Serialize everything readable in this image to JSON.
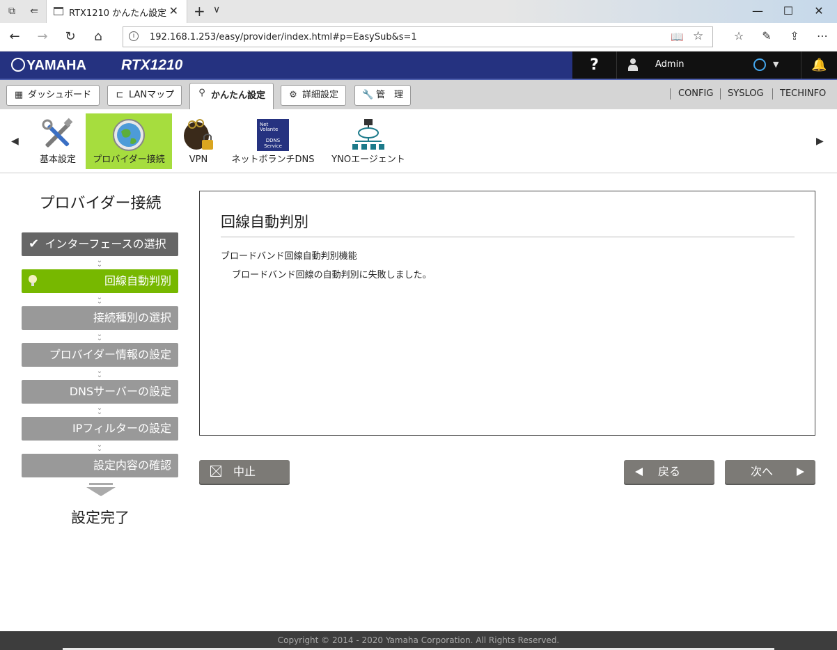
{
  "browser": {
    "tab_title": "RTX1210 かんたん設定 - ",
    "url": "192.168.1.253/easy/provider/index.html#p=EasySub&s=1"
  },
  "header": {
    "brand": "YAMAHA",
    "model": "RTX1210",
    "help_label": "?",
    "user": "Admin",
    "status_color": "#44a7ee"
  },
  "main_tabs": [
    {
      "label": "ダッシュボード",
      "icon": "dashboard-icon"
    },
    {
      "label": "LANマップ",
      "icon": "lan-map-icon"
    },
    {
      "label": "かんたん設定",
      "icon": "wand-icon",
      "active": true
    },
    {
      "label": "詳細設定",
      "icon": "gear-icon"
    },
    {
      "label": "管　理",
      "icon": "wrench-icon"
    }
  ],
  "top_links": [
    "CONFIG",
    "SYSLOG",
    "TECHINFO"
  ],
  "sub_items": [
    {
      "label": "基本設定",
      "icon": "tools-icon"
    },
    {
      "label": "プロバイダー接続",
      "icon": "globe-icon",
      "active": true
    },
    {
      "label": "VPN",
      "icon": "keys-lock-icon"
    },
    {
      "label": "ネットボランチDNS",
      "icon": "ddns-service-icon",
      "badge_text": "DDNS Service"
    },
    {
      "label": "YNOエージェント",
      "icon": "network-cloud-icon"
    }
  ],
  "sidebar": {
    "title": "プロバイダー接続",
    "steps": [
      {
        "label": "インターフェースの選択",
        "state": "done"
      },
      {
        "label": "回線自動判別",
        "state": "current"
      },
      {
        "label": "接続種別の選択",
        "state": "todo"
      },
      {
        "label": "プロバイダー情報の設定",
        "state": "todo"
      },
      {
        "label": "DNSサーバーの設定",
        "state": "todo"
      },
      {
        "label": "IPフィルターの設定",
        "state": "todo"
      },
      {
        "label": "設定内容の確認",
        "state": "todo"
      }
    ],
    "finish": "設定完了"
  },
  "panel": {
    "title": "回線自動判別",
    "label": "ブロードバンド回線自動判別機能",
    "message": "ブロードバンド回線の自動判別に失敗しました。"
  },
  "buttons": {
    "cancel": "中止",
    "back": "戻る",
    "next": "次へ"
  },
  "footer": "Copyright © 2014 - 2020 Yamaha Corporation. All Rights Reserved.",
  "colors": {
    "header_blue": "#253280",
    "active_green": "#a6dd3e",
    "step_current": "#77b800",
    "step_done": "#666666",
    "step_todo": "#999999"
  }
}
